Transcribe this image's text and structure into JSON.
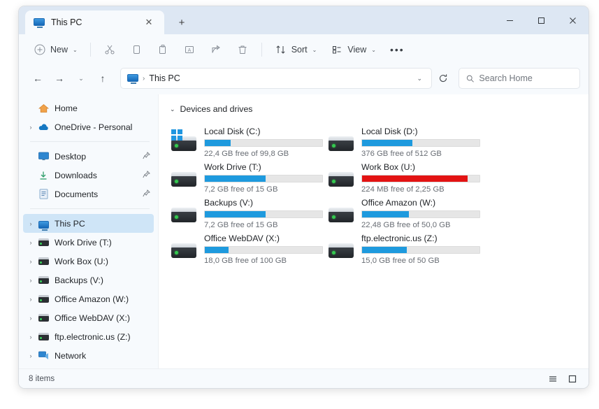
{
  "window": {
    "tab_title": "This PC",
    "tab_icon": "monitor-icon",
    "close_tab_glyph": "✕",
    "new_tab_glyph": "+",
    "minimize_glyph": "—",
    "maximize_glyph": "▢",
    "close_glyph": "✕"
  },
  "toolbar": {
    "new_label": "New",
    "sort_label": "Sort",
    "view_label": "View",
    "more_label": "•••",
    "chevron": "⌄",
    "items": [
      {
        "name": "new-button",
        "label": "New",
        "icon": "plus-circle-icon"
      },
      {
        "name": "cut-button",
        "label": "",
        "icon": "scissors-icon"
      },
      {
        "name": "copy-button",
        "label": "",
        "icon": "copy-icon"
      },
      {
        "name": "paste-button",
        "label": "",
        "icon": "paste-icon"
      },
      {
        "name": "rename-button",
        "label": "",
        "icon": "rename-icon"
      },
      {
        "name": "share-button",
        "label": "",
        "icon": "share-icon"
      },
      {
        "name": "delete-button",
        "label": "",
        "icon": "trash-icon"
      },
      {
        "name": "sort-button",
        "label": "Sort",
        "icon": "sort-icon"
      },
      {
        "name": "view-button",
        "label": "View",
        "icon": "view-icon"
      }
    ]
  },
  "address": {
    "back_glyph": "←",
    "forward_glyph": "→",
    "recent_glyph": "⌄",
    "up_glyph": "↑",
    "crumb_icon": "monitor-icon",
    "crumb_separator": "›",
    "crumb_text": "This PC",
    "dropdown_glyph": "⌄",
    "refresh_glyph": "⟳",
    "search_icon": "search-icon",
    "search_placeholder": "Search Home",
    "search_value": ""
  },
  "sidebar": {
    "expand_glyph": "›",
    "pin_glyph": "📌",
    "items": [
      {
        "label": "Home",
        "icon": "home-icon",
        "expandable": false,
        "pinned": false,
        "selected": false,
        "divider_after": false
      },
      {
        "label": "OneDrive - Personal",
        "icon": "cloud-icon",
        "expandable": true,
        "pinned": false,
        "selected": false,
        "divider_after": true
      },
      {
        "label": "Desktop",
        "icon": "desktop-icon",
        "expandable": false,
        "pinned": true,
        "selected": false,
        "divider_after": false
      },
      {
        "label": "Downloads",
        "icon": "download-icon",
        "expandable": false,
        "pinned": true,
        "selected": false,
        "divider_after": false
      },
      {
        "label": "Documents",
        "icon": "document-icon",
        "expandable": false,
        "pinned": true,
        "selected": false,
        "divider_after": true
      },
      {
        "label": "This PC",
        "icon": "monitor-icon",
        "expandable": true,
        "pinned": false,
        "selected": true,
        "divider_after": false
      },
      {
        "label": "Work Drive (T:)",
        "icon": "drive-icon",
        "expandable": true,
        "pinned": false,
        "selected": false,
        "divider_after": false
      },
      {
        "label": "Work Box (U:)",
        "icon": "drive-icon",
        "expandable": true,
        "pinned": false,
        "selected": false,
        "divider_after": false
      },
      {
        "label": "Backups (V:)",
        "icon": "drive-icon",
        "expandable": true,
        "pinned": false,
        "selected": false,
        "divider_after": false
      },
      {
        "label": "Office Amazon (W:)",
        "icon": "drive-icon",
        "expandable": true,
        "pinned": false,
        "selected": false,
        "divider_after": false
      },
      {
        "label": "Office WebDAV (X:)",
        "icon": "drive-icon",
        "expandable": true,
        "pinned": false,
        "selected": false,
        "divider_after": false
      },
      {
        "label": "ftp.electronic.us (Z:)",
        "icon": "drive-icon",
        "expandable": true,
        "pinned": false,
        "selected": false,
        "divider_after": false
      },
      {
        "label": "Network",
        "icon": "network-icon",
        "expandable": true,
        "pinned": false,
        "selected": false,
        "divider_after": false
      }
    ]
  },
  "content": {
    "group_chevron": "⌄",
    "group_title": "Devices and drives",
    "drives": [
      {
        "name": "Local Disk (C:)",
        "usage_text": "22,4 GB free of 99,8 GB",
        "fill_percent": 22,
        "state": "normal",
        "system": true
      },
      {
        "name": "Local Disk (D:)",
        "usage_text": "376 GB free of 512 GB",
        "fill_percent": 43,
        "state": "normal",
        "system": false
      },
      {
        "name": "Work Drive (T:)",
        "usage_text": "7,2 GB free of 15 GB",
        "fill_percent": 52,
        "state": "normal",
        "system": false
      },
      {
        "name": "Work Box (U:)",
        "usage_text": "224 MB free of 2,25 GB",
        "fill_percent": 90,
        "state": "danger",
        "system": false
      },
      {
        "name": "Backups (V:)",
        "usage_text": "7,2 GB free of 15 GB",
        "fill_percent": 52,
        "state": "normal",
        "system": false
      },
      {
        "name": "Office Amazon (W:)",
        "usage_text": "22,48 GB free of 50,0 GB",
        "fill_percent": 40,
        "state": "normal",
        "system": false
      },
      {
        "name": "Office WebDAV (X:)",
        "usage_text": "18,0 GB free of 100 GB",
        "fill_percent": 20,
        "state": "normal",
        "system": false
      },
      {
        "name": "ftp.electronic.us (Z:)",
        "usage_text": "15,0 GB free of 50 GB",
        "fill_percent": 38,
        "state": "normal",
        "system": false
      }
    ]
  },
  "statusbar": {
    "item_count_text": "8 items",
    "details_view_icon": "list-view-icon",
    "large_icons_view_icon": "tile-view-icon"
  },
  "colors": {
    "accent": "#1e9ade",
    "danger": "#e31313",
    "titlebar": "#dde7f3",
    "chrome": "#f7fafd",
    "selection": "#cfe5f7"
  }
}
